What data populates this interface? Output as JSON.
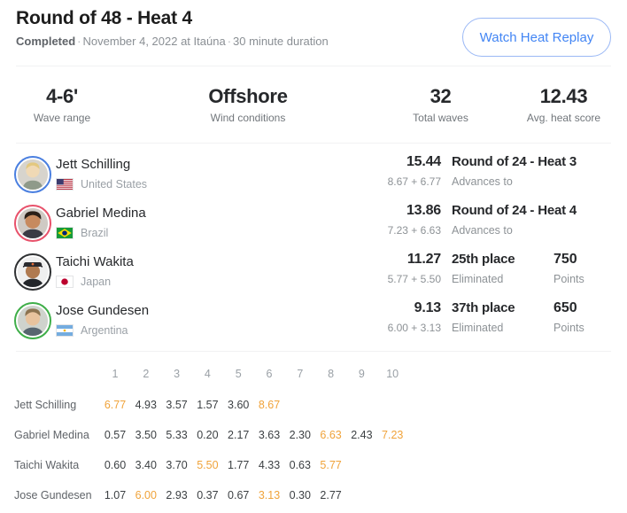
{
  "header": {
    "title": "Round of 48 - Heat 4",
    "status": "Completed",
    "date": "November 4, 2022 at Itaúna",
    "duration": "30 minute duration",
    "separator": "·",
    "replay_button": "Watch Heat Replay",
    "accent_color": "#4285f4"
  },
  "stats": [
    {
      "value": "4-6'",
      "label": "Wave range"
    },
    {
      "value": "Offshore",
      "label": "Wind conditions"
    },
    {
      "value": "32",
      "label": "Total waves"
    },
    {
      "value": "12.43",
      "label": "Avg. heat score"
    }
  ],
  "athletes": [
    {
      "name": "Jett Schilling",
      "country": "United States",
      "flag": "flag-united-states",
      "ring_color": "#4a7fe0",
      "total": "15.44",
      "parts": "8.67 + 6.77",
      "result": "Round of 24 - Heat 3",
      "result_sub": "Advances to",
      "points": "",
      "points_label": "",
      "has_points": false
    },
    {
      "name": "Gabriel Medina",
      "country": "Brazil",
      "flag": "flag-brazil",
      "ring_color": "#e8526b",
      "total": "13.86",
      "parts": "7.23 + 6.63",
      "result": "Round of 24 - Heat 4",
      "result_sub": "Advances to",
      "points": "",
      "points_label": "",
      "has_points": false
    },
    {
      "name": "Taichi Wakita",
      "country": "Japan",
      "flag": "flag-japan",
      "ring_color": "#2f3133",
      "total": "11.27",
      "parts": "5.77 + 5.50",
      "result": "25th place",
      "result_sub": "Eliminated",
      "points": "750",
      "points_label": "Points",
      "has_points": true
    },
    {
      "name": "Jose Gundesen",
      "country": "Argentina",
      "flag": "flag-argentina",
      "ring_color": "#3fae49",
      "total": "9.13",
      "parts": "6.00 + 3.13",
      "result": "37th place",
      "result_sub": "Eliminated",
      "points": "650",
      "points_label": "Points",
      "has_points": true
    }
  ],
  "wave_table": {
    "highlight_color": "#f0a33a",
    "columns": [
      "1",
      "2",
      "3",
      "4",
      "5",
      "6",
      "7",
      "8",
      "9",
      "10"
    ],
    "rows": [
      {
        "athlete": "Jett Schilling",
        "scores": [
          "6.77",
          "4.93",
          "3.57",
          "1.57",
          "3.60",
          "8.67"
        ],
        "best": [
          0,
          5
        ]
      },
      {
        "athlete": "Gabriel Medina",
        "scores": [
          "0.57",
          "3.50",
          "5.33",
          "0.20",
          "2.17",
          "3.63",
          "2.30",
          "6.63",
          "2.43",
          "7.23"
        ],
        "best": [
          7,
          9
        ]
      },
      {
        "athlete": "Taichi Wakita",
        "scores": [
          "0.60",
          "3.40",
          "3.70",
          "5.50",
          "1.77",
          "4.33",
          "0.63",
          "5.77"
        ],
        "best": [
          3,
          7
        ]
      },
      {
        "athlete": "Jose Gundesen",
        "scores": [
          "1.07",
          "6.00",
          "2.93",
          "0.37",
          "0.67",
          "3.13",
          "0.30",
          "2.77"
        ],
        "best": [
          1,
          5
        ]
      }
    ]
  }
}
